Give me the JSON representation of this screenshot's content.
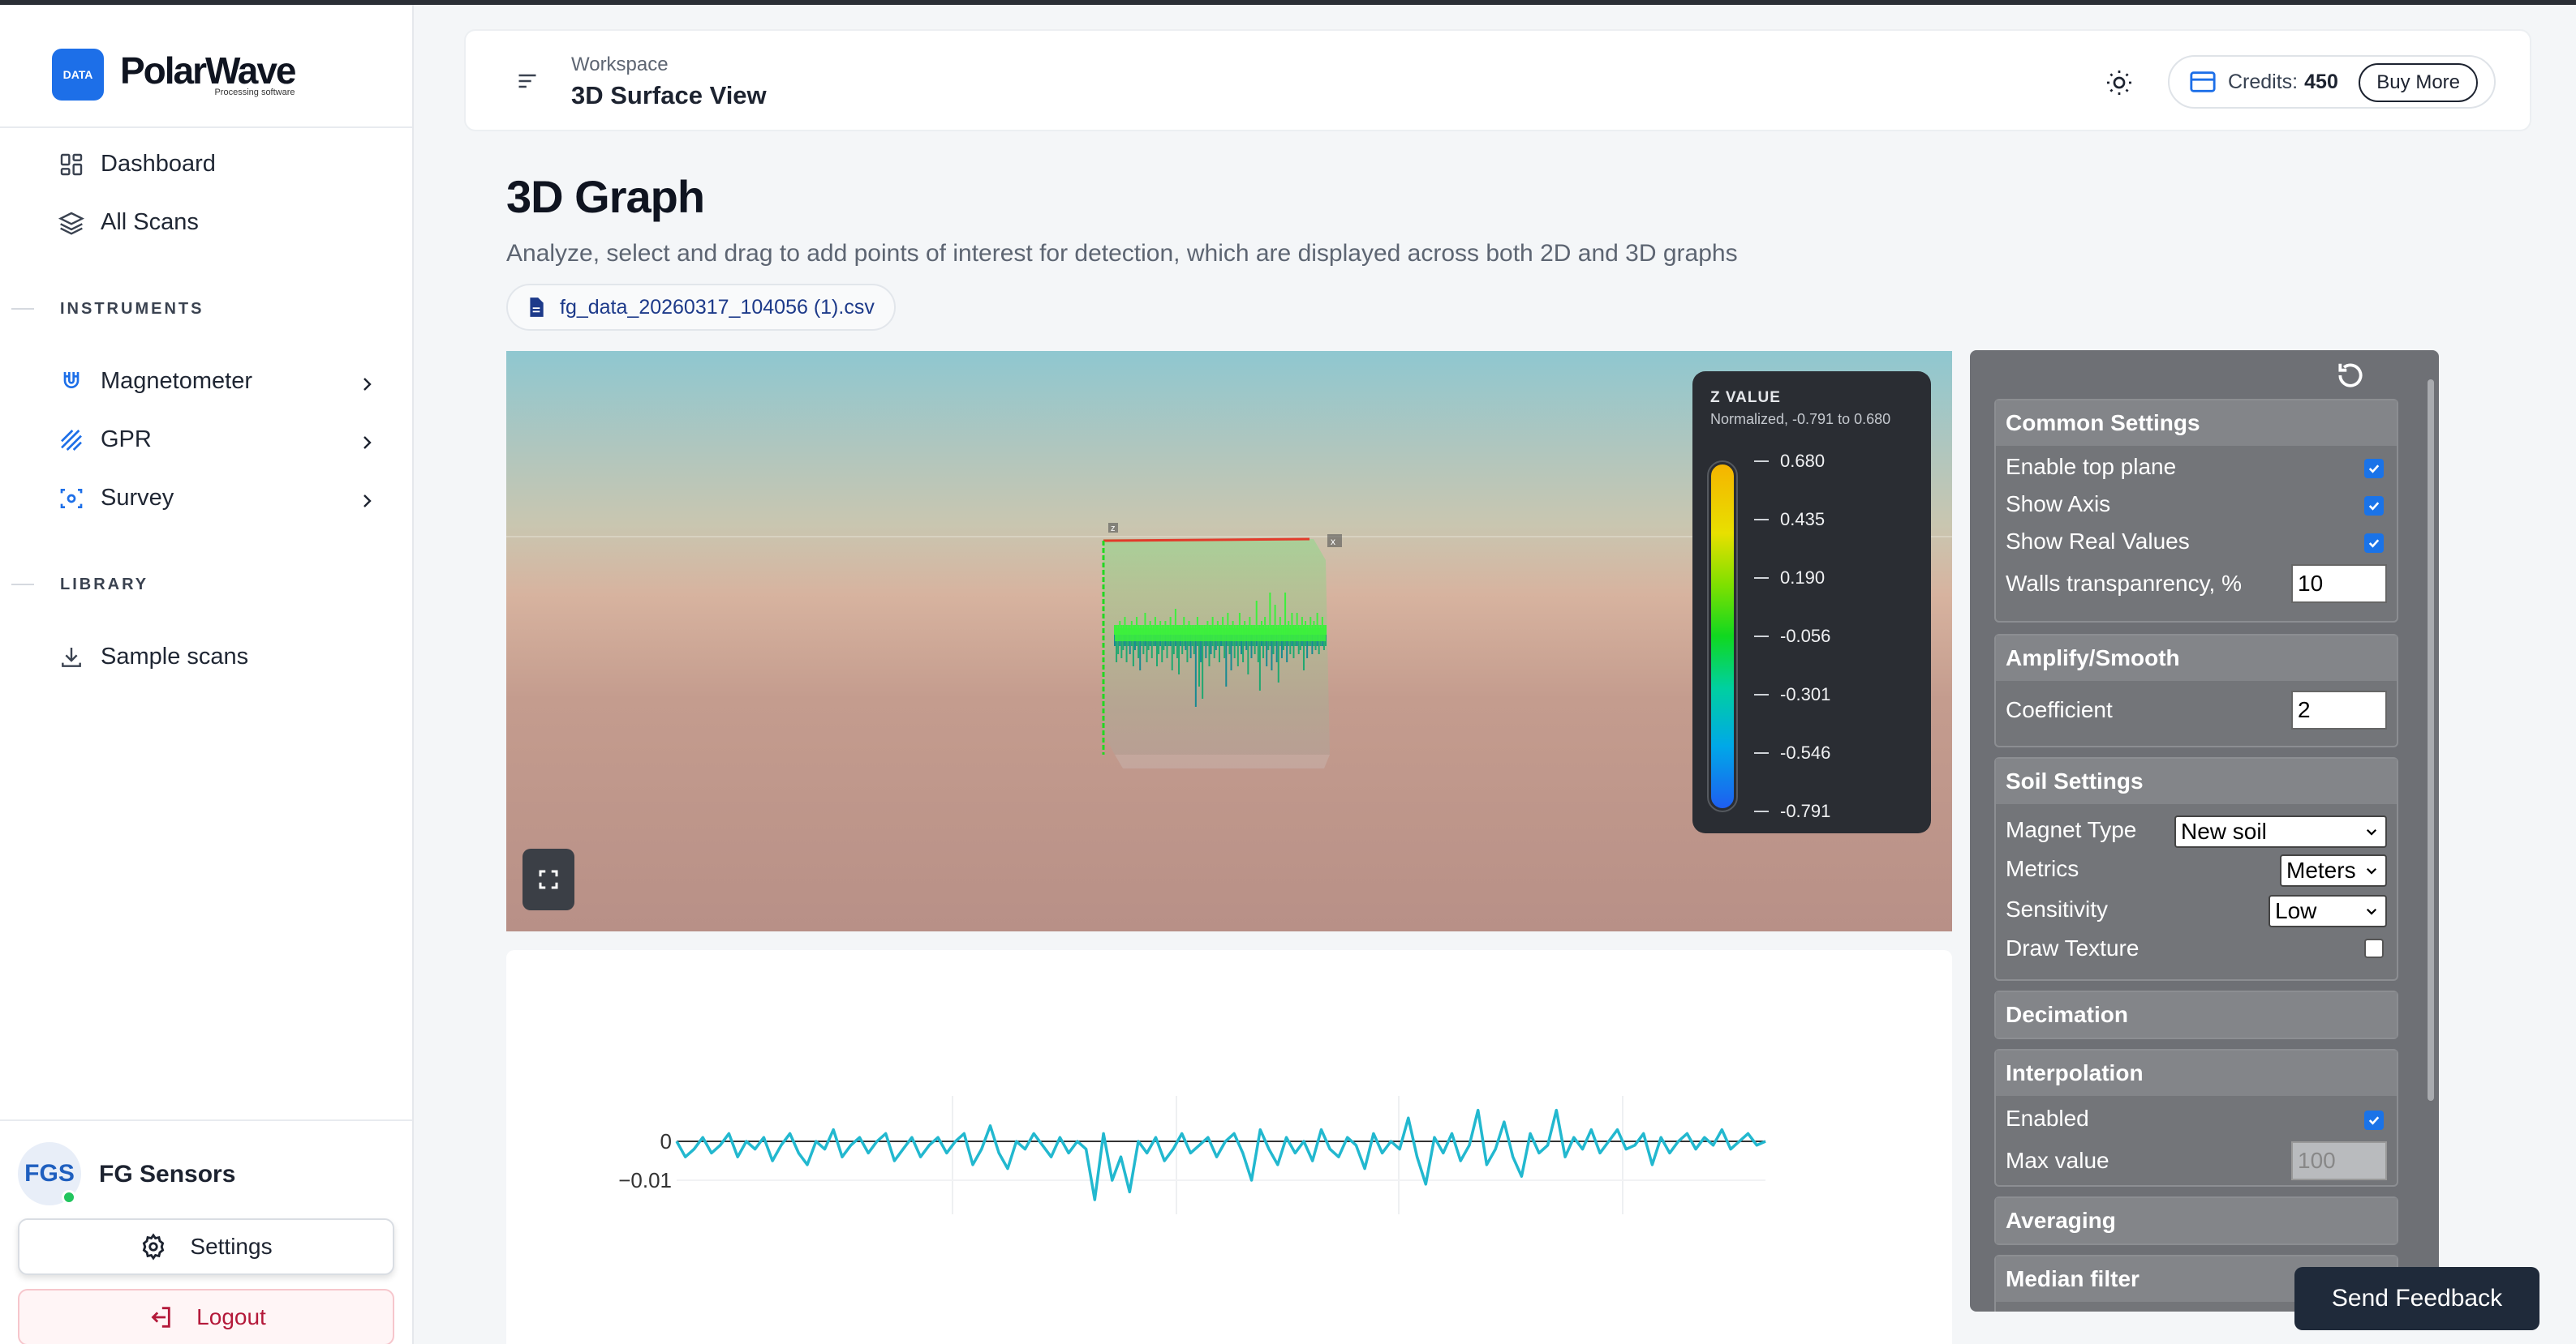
{
  "app": {
    "name": "PolarWave",
    "tagline": "Processing software",
    "logo_badge": "DATA"
  },
  "sidebar": {
    "top_items": [
      {
        "label": "Dashboard",
        "icon": "dashboard-icon"
      },
      {
        "label": "All Scans",
        "icon": "layers-icon"
      }
    ],
    "instruments_label": "INSTRUMENTS",
    "instruments": [
      {
        "label": "Magnetometer",
        "icon": "magnet-icon"
      },
      {
        "label": "GPR",
        "icon": "gpr-icon"
      },
      {
        "label": "Survey",
        "icon": "survey-icon"
      }
    ],
    "library_label": "LIBRARY",
    "library": [
      {
        "label": "Sample scans",
        "icon": "download-icon"
      }
    ],
    "user": {
      "initials": "FGS",
      "name": "FG Sensors"
    },
    "settings_label": "Settings",
    "logout_label": "Logout"
  },
  "header": {
    "breadcrumb": "Workspace",
    "title": "3D Surface View",
    "credits_label": "Credits:",
    "credits_value": "450",
    "buy_label": "Buy More"
  },
  "main": {
    "title": "3D Graph",
    "description": "Analyze, select and drag to add points of interest for detection, which are displayed across both 2D and 3D graphs",
    "file_name": "fg_data_20260317_104056 (1).csv"
  },
  "legend": {
    "title": "Z VALUE",
    "subtitle": "Normalized, -0.791 to 0.680",
    "ticks": [
      "0.680",
      "0.435",
      "0.190",
      "-0.056",
      "-0.301",
      "-0.546",
      "-0.791"
    ]
  },
  "chart_data": {
    "type": "line",
    "y_ticks": [
      "0",
      "−0.01"
    ],
    "ylim": [
      -0.016,
      0.01
    ],
    "color": "#22b8cf",
    "values": [
      0.0,
      -0.004,
      -0.002,
      0.001,
      -0.003,
      -0.001,
      0.002,
      -0.004,
      0.0,
      -0.002,
      0.001,
      -0.005,
      -0.001,
      0.002,
      -0.003,
      -0.006,
      0.0,
      -0.002,
      0.003,
      -0.004,
      -0.001,
      0.001,
      -0.003,
      0.0,
      0.002,
      -0.005,
      -0.002,
      0.001,
      -0.004,
      -0.001,
      0.001,
      -0.003,
      0.0,
      0.002,
      -0.006,
      -0.002,
      0.004,
      -0.003,
      -0.007,
      0.0,
      -0.002,
      0.002,
      -0.001,
      -0.004,
      0.001,
      -0.003,
      0.0,
      -0.002,
      -0.015,
      0.002,
      -0.01,
      -0.004,
      -0.013,
      0.0,
      -0.003,
      0.001,
      -0.005,
      -0.002,
      0.002,
      -0.003,
      -0.001,
      0.001,
      -0.004,
      0.0,
      0.002,
      -0.003,
      -0.01,
      0.003,
      -0.002,
      -0.006,
      0.001,
      -0.003,
      0.0,
      -0.005,
      0.003,
      -0.002,
      -0.004,
      0.001,
      -0.001,
      -0.007,
      0.002,
      -0.003,
      0.0,
      -0.002,
      0.006,
      -0.004,
      -0.011,
      0.001,
      -0.003,
      0.002,
      -0.005,
      -0.001,
      0.008,
      -0.006,
      -0.002,
      0.005,
      -0.004,
      -0.009,
      0.002,
      -0.003,
      -0.001,
      0.008,
      -0.004,
      0.001,
      -0.002,
      0.003,
      -0.003,
      0.0,
      0.003,
      -0.002,
      -0.001,
      0.002,
      -0.006,
      0.001,
      -0.003,
      0.0,
      0.002,
      -0.002,
      0.001,
      -0.001,
      0.003,
      -0.002,
      0.0,
      0.002,
      -0.001,
      0.0
    ]
  },
  "panel": {
    "common": {
      "title": "Common Settings",
      "enable_top_plane": "Enable top plane",
      "show_axis": "Show Axis",
      "show_real_values": "Show Real Values",
      "walls_label": "Walls transpanrency, %",
      "walls_value": "10"
    },
    "amplify": {
      "title": "Amplify/Smooth",
      "coefficient_label": "Coefficient",
      "coefficient_value": "2"
    },
    "soil": {
      "title": "Soil Settings",
      "magnet_label": "Magnet Type",
      "magnet_value": "New soil",
      "metrics_label": "Metrics",
      "metrics_value": "Meters",
      "sensitivity_label": "Sensitivity",
      "sensitivity_value": "Low",
      "texture_label": "Draw Texture"
    },
    "decimation": {
      "title": "Decimation"
    },
    "interpolation": {
      "title": "Interpolation",
      "enabled_label": "Enabled",
      "max_label": "Max value",
      "max_value": "100"
    },
    "averaging": {
      "title": "Averaging"
    },
    "median": {
      "title": "Median filter"
    }
  },
  "feedback_label": "Send Feedback"
}
